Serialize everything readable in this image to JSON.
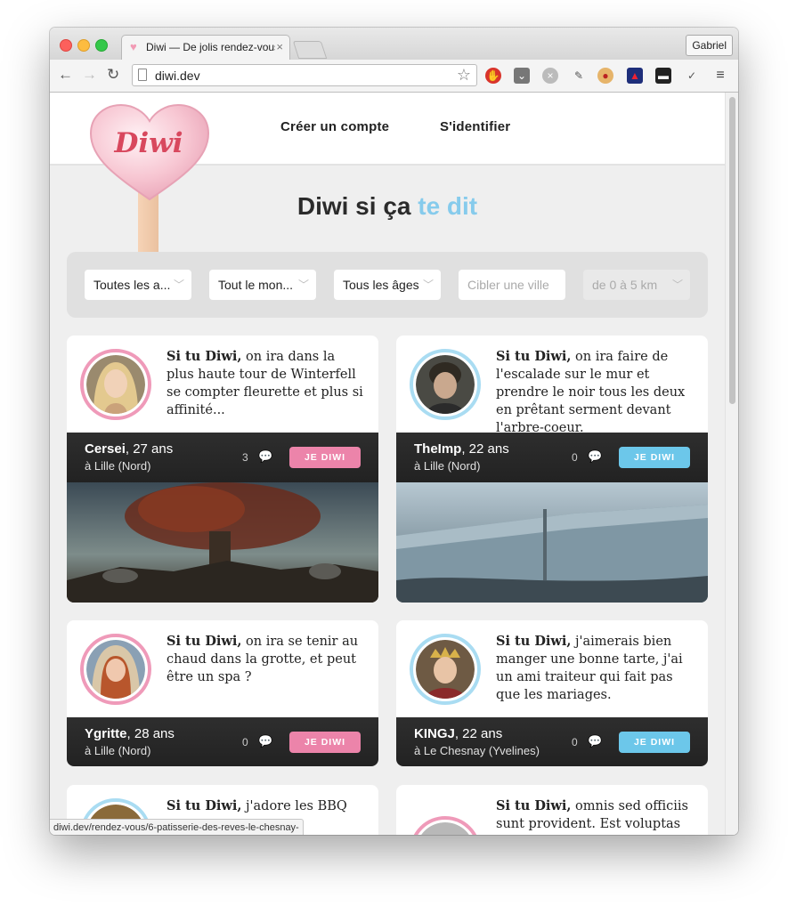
{
  "browser": {
    "tab_title": "Diwi — De jolis rendez-vous",
    "profile": "Gabriel",
    "url": "diwi.dev",
    "status_url": "diwi.dev/rendez-vous/6-patisserie-des-reves-le-chesnay-"
  },
  "site": {
    "logo_text": "Diwi",
    "nav": [
      "Créer un compte",
      "S'identifier"
    ],
    "hero_main": "Diwi si ça",
    "hero_accent": "te dit"
  },
  "filters": {
    "activities": "Toutes les a...",
    "people": "Tout le mon...",
    "ages": "Tous les âges",
    "city_placeholder": "Cibler une ville",
    "distance": "de 0 à 5 km"
  },
  "cards": [
    {
      "intro": "Si tu Diwi,",
      "text": " on ira dans la plus haute tour de Winterfell se compter fleurette et plus si affinité...",
      "name": "Cersei",
      "age": ", 27 ans",
      "city": "à Lille (Nord)",
      "count": "3",
      "button": "JE DIWI",
      "color": "#ec84aa"
    },
    {
      "intro": "Si tu Diwi,",
      "text": " on ira faire de l'escalade sur le mur et prendre le noir tous les deux en prêtant serment devant l'arbre-coeur.",
      "name": "TheImp",
      "age": ", 22 ans",
      "city": "à Lille (Nord)",
      "count": "0",
      "button": "JE DIWI",
      "color": "#6cc7ea"
    },
    {
      "intro": "Si tu Diwi,",
      "text": " on ira se tenir au chaud dans la grotte, et peut être un spa ?",
      "name": "Ygritte",
      "age": ", 28 ans",
      "city": "à Lille (Nord)",
      "count": "0",
      "button": "JE DIWI",
      "color": "#ec84aa"
    },
    {
      "intro": "Si tu Diwi,",
      "text": " j'aimerais bien manger une bonne tarte, j'ai un ami traiteur qui fait pas que les mariages.",
      "name": "KINGJ",
      "age": ", 22 ans",
      "city": "à Le Chesnay (Yvelines)",
      "count": "0",
      "button": "JE DIWI",
      "color": "#6cc7ea"
    },
    {
      "intro": "Si tu Diwi,",
      "text": " j'adore les BBQ"
    },
    {
      "intro": "Si tu Diwi,",
      "text": " omnis sed officiis sunt provident. Est voluptas rem"
    }
  ]
}
